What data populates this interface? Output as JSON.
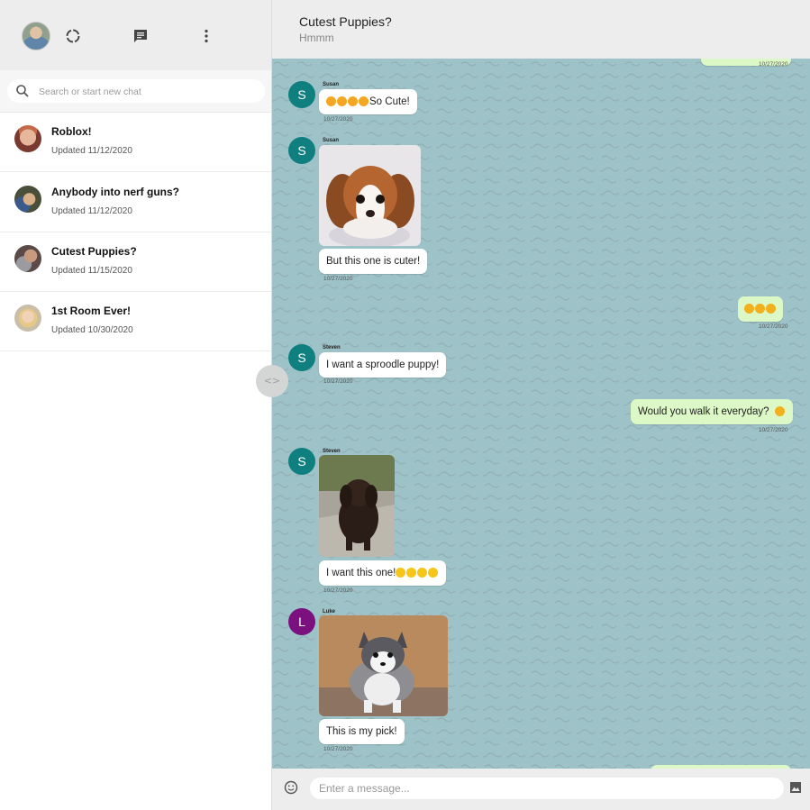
{
  "sidebar": {
    "search_placeholder": "Search or start new chat",
    "rooms": [
      {
        "title": "Roblox!",
        "updated": "Updated 11/12/2020"
      },
      {
        "title": "Anybody into nerf guns?",
        "updated": "Updated 11/12/2020"
      },
      {
        "title": "Cutest Puppies?",
        "updated": "Updated 11/15/2020"
      },
      {
        "title": "1st Room Ever!",
        "updated": "Updated 10/30/2020"
      }
    ]
  },
  "chat": {
    "title": "Cutest Puppies?",
    "subtitle": "Hmmm",
    "input_placeholder": "Enter a message...",
    "messages": [
      {
        "sender": "Susan",
        "initial": "S",
        "text": "So Cute!",
        "time": "10/27/2020"
      },
      {
        "sender": "Susan",
        "initial": "S",
        "text": "But this one is cuter!",
        "time": "10/27/2020"
      },
      {
        "sender": "",
        "text": "",
        "time": "10/27/2020"
      },
      {
        "sender": "Steven",
        "initial": "S",
        "text": "I want a sproodle puppy!",
        "time": "10/27/2020"
      },
      {
        "sender": "",
        "text": "Would you walk it everyday?",
        "time": "10/27/2020"
      },
      {
        "sender": "Steven",
        "initial": "S",
        "text": "I want this one!",
        "time": "10/27/2020"
      },
      {
        "sender": "Luke",
        "initial": "L",
        "text": "This is my pick!",
        "time": "10/27/2020"
      }
    ],
    "top_time": "10/27/2020"
  },
  "colors": {
    "susan_avatar": "#0f7f7f",
    "steven_avatar": "#0f7f7f",
    "luke_avatar": "#7b117f",
    "chat_bg": "#9dc3c8",
    "outgoing_bubble": "#dcf8c6"
  },
  "icons": [
    "search-icon",
    "status-icon",
    "chat-icon",
    "more-vert-icon",
    "code-icon",
    "emoji-icon",
    "image-icon"
  ]
}
